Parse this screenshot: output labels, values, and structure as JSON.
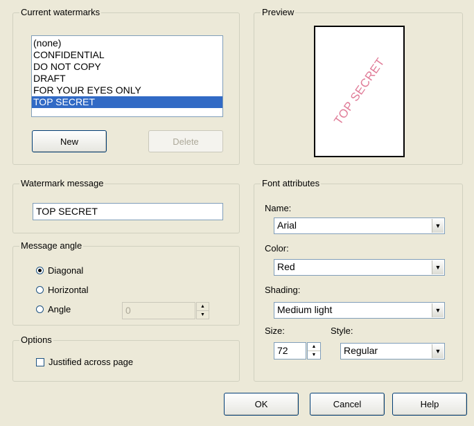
{
  "current_watermarks": {
    "title": "Current watermarks",
    "items": [
      "(none)",
      "CONFIDENTIAL",
      "DO NOT COPY",
      "DRAFT",
      "FOR YOUR EYES ONLY",
      "TOP SECRET"
    ],
    "selected_index": 5,
    "new_label": "New",
    "delete_label": "Delete"
  },
  "preview": {
    "title": "Preview",
    "watermark_text": "TOP SECRET",
    "watermark_color": "#e07b97"
  },
  "watermark_message": {
    "title": "Watermark message",
    "value": "TOP SECRET"
  },
  "message_angle": {
    "title": "Message angle",
    "diagonal_label": "Diagonal",
    "horizontal_label": "Horizontal",
    "angle_label": "Angle",
    "selected": "Diagonal",
    "angle_value": "0"
  },
  "options": {
    "title": "Options",
    "justified_label": "Justified across page",
    "justified_checked": false
  },
  "font_attributes": {
    "title": "Font attributes",
    "name_label": "Name:",
    "name_value": "Arial",
    "color_label": "Color:",
    "color_value": "Red",
    "shading_label": "Shading:",
    "shading_value": "Medium light",
    "size_label": "Size:",
    "size_value": "72",
    "style_label": "Style:",
    "style_value": "Regular"
  },
  "buttons": {
    "ok_label": "OK",
    "cancel_label": "Cancel",
    "help_label": "Help"
  },
  "colors": {
    "dialog_background": "#ece9d8",
    "selection": "#316ac5"
  }
}
